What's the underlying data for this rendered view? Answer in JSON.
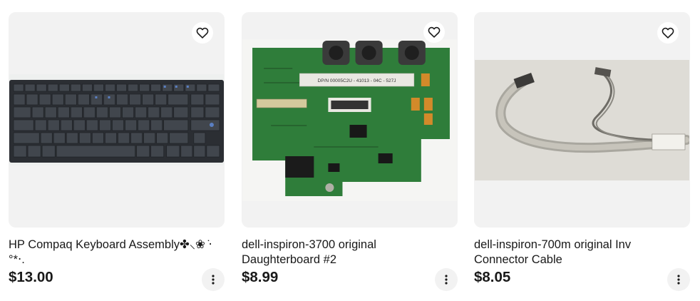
{
  "listings": [
    {
      "title": "HP Compaq Keyboard Assembly✤⸜❀ ̇‧°*‧.",
      "price": "$13.00",
      "image": "keyboard"
    },
    {
      "title": "dell-inspiron-3700 original Daughterboard #2",
      "price": "$8.99",
      "image": "circuit-board",
      "label_text": "DP/N 00005C2U - 41013 - 04C - 527J"
    },
    {
      "title": "dell-inspiron-700m original Inv Connector Cable",
      "price": "$8.05",
      "image": "ribbon-cable"
    }
  ],
  "icons": {
    "favorite": "heart-outline-icon",
    "more": "vertical-dots-icon"
  },
  "colors": {
    "text": "#191919",
    "image_bg": "#f2f2f2",
    "button_bg": "#f2f2f2"
  }
}
